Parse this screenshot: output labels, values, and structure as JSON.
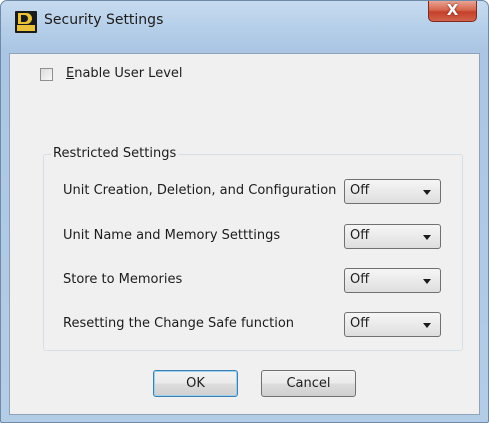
{
  "window": {
    "title": "Security Settings",
    "app_icon": "d2000-app-icon",
    "close_glyph": "X"
  },
  "options": {
    "enable_user_level": {
      "mnemonic": "E",
      "label_rest": "nable User Level",
      "checked": false
    }
  },
  "restricted": {
    "group_label": "Restricted Settings",
    "settings": [
      {
        "label": "Unit Creation, Deletion, and Configuration",
        "value": "Off"
      },
      {
        "label": "Unit Name and Memory Setttings",
        "value": "Off"
      },
      {
        "label": "Store to Memories",
        "value": "Off"
      },
      {
        "label": "Resetting the Change Safe function",
        "value": "Off"
      }
    ]
  },
  "buttons": {
    "ok": "OK",
    "cancel": "Cancel"
  },
  "colors": {
    "title_bar": "#b6cfe9",
    "close_button": "#c4402a",
    "client_bg": "#f0f0f0"
  }
}
